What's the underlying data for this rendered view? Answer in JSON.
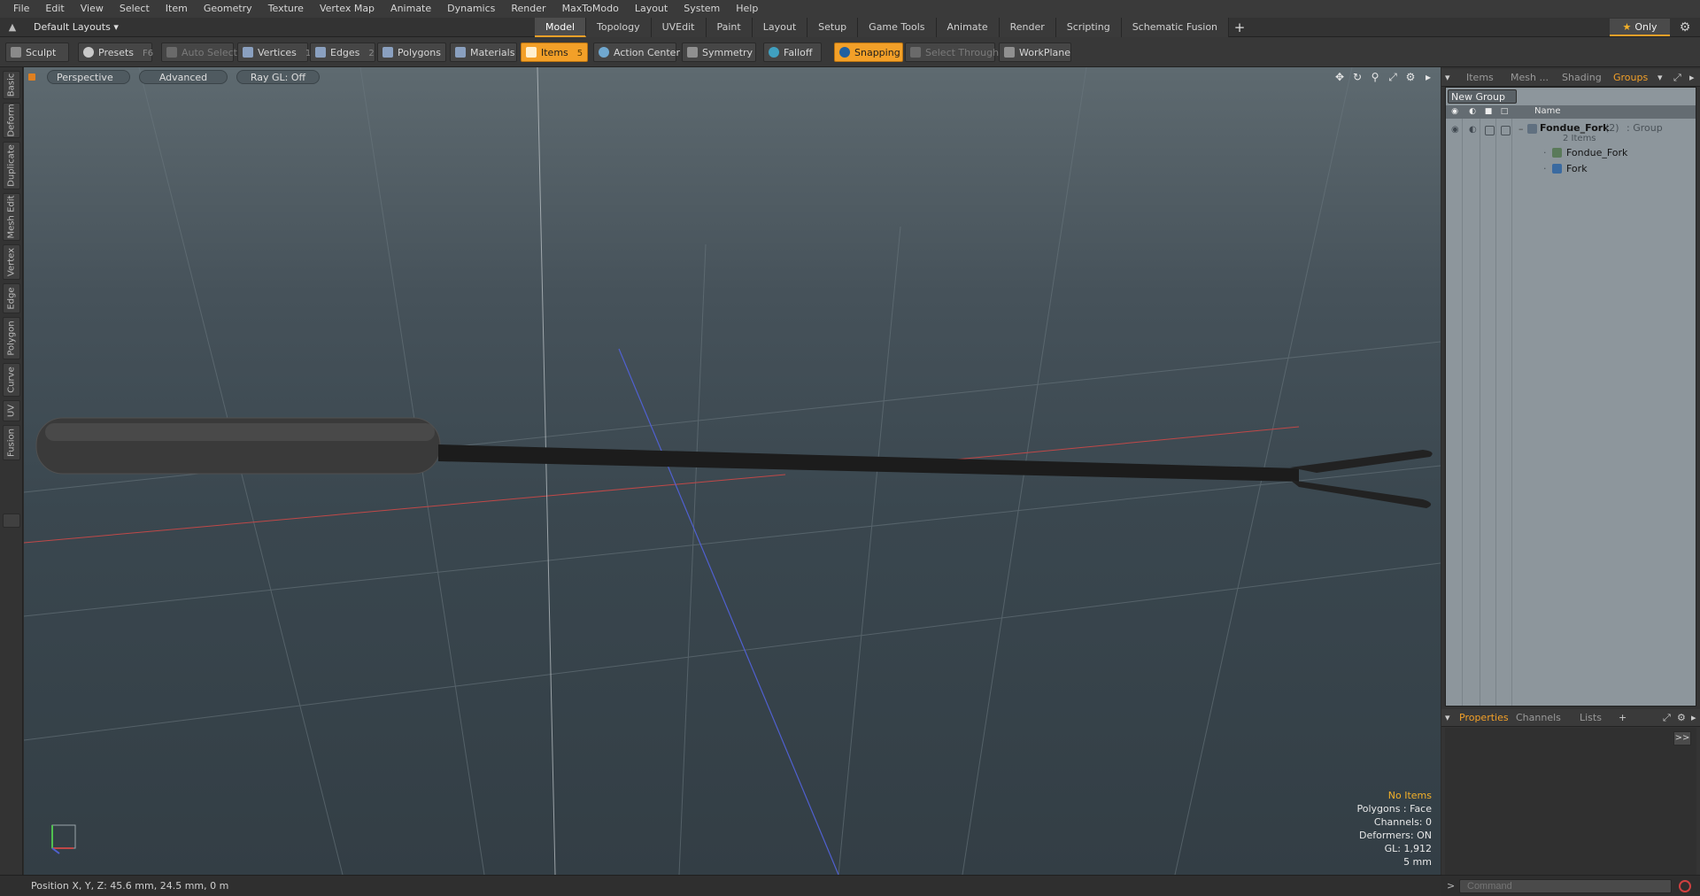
{
  "menubar": {
    "items": [
      "File",
      "Edit",
      "View",
      "Select",
      "Item",
      "Geometry",
      "Texture",
      "Vertex Map",
      "Animate",
      "Dynamics",
      "Render",
      "MaxToModo",
      "Layout",
      "System",
      "Help"
    ]
  },
  "layoutbar": {
    "dropdown": "Default Layouts",
    "tabs": [
      "Model",
      "Topology",
      "UVEdit",
      "Paint",
      "Layout",
      "Setup",
      "Game Tools",
      "Animate",
      "Render",
      "Scripting",
      "Schematic Fusion"
    ],
    "active_tab": "Model",
    "only_label": "Only"
  },
  "toolbar": {
    "sculpt": "Sculpt",
    "presets": "Presets",
    "presets_key": "F6",
    "auto_select": "Auto Select",
    "vertices": "Vertices",
    "vertices_key": "1",
    "edges": "Edges",
    "edges_key": "2",
    "polygons": "Polygons",
    "materials": "Materials",
    "items": "Items",
    "items_key": "5",
    "action_center": "Action Center",
    "symmetry": "Symmetry",
    "falloff": "Falloff",
    "snapping": "Snapping",
    "select_through": "Select Through",
    "workplane": "WorkPlane"
  },
  "left_tabs": [
    "Basic",
    "Deform",
    "Duplicate",
    "Mesh Edit",
    "Vertex",
    "Edge",
    "Polygon",
    "Curve",
    "UV",
    "Fusion"
  ],
  "viewport": {
    "perspective": "Perspective",
    "advanced": "Advanced",
    "raygl": "Ray GL: Off",
    "info": {
      "no_items": "No Items",
      "polygons": "Polygons : Face",
      "channels": "Channels: 0",
      "deformers": "Deformers: ON",
      "gl": "GL: 1,912",
      "scale": "5 mm"
    }
  },
  "statusbar": {
    "position": "Position X, Y, Z:  45.6 mm, 24.5 mm, 0 m"
  },
  "right_panel": {
    "tabs": [
      "Items",
      "Mesh ...",
      "Shading",
      "Groups"
    ],
    "active_tab": "Groups",
    "new_group": "New Group",
    "name_header": "Name",
    "tree": {
      "group_name": "Fondue_Fork",
      "group_count": "(2)",
      "group_type": ": Group",
      "group_items": "2 Items",
      "child1": "Fondue_Fork",
      "child2": "Fork"
    },
    "bottom_tabs": [
      "Properties",
      "Channels",
      "Lists"
    ],
    "bottom_active": "Properties",
    "expand_label": ">>",
    "command_placeholder": "Command"
  },
  "colors": {
    "accent": "#f3a028",
    "grid_x": "#c04848",
    "grid_y": "#50c050",
    "grid_z": "#5060d0"
  }
}
